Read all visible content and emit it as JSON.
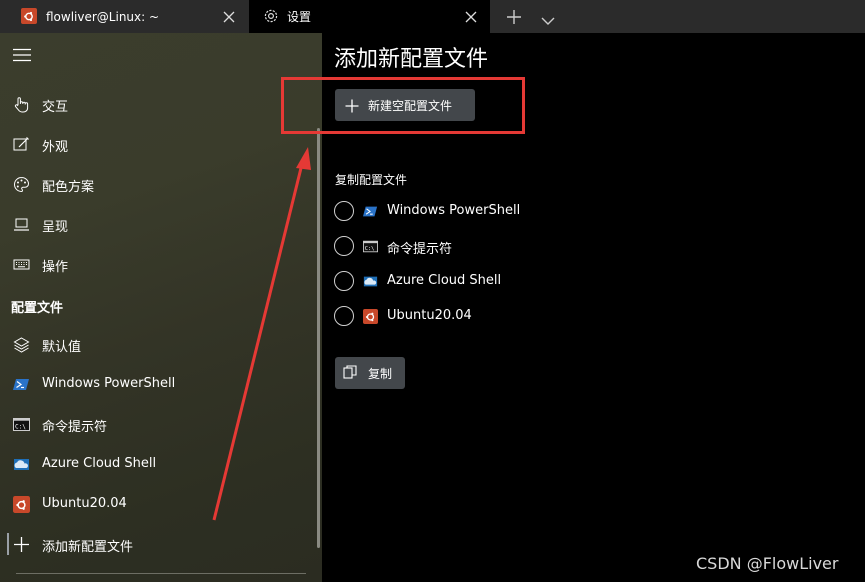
{
  "tabs": [
    {
      "label": "flowliver@Linux: ~",
      "icon": "ubuntu-icon",
      "active": false
    },
    {
      "label": "设置",
      "icon": "gear-icon",
      "active": true
    }
  ],
  "tabbar": {
    "new_tab_icon": "plus-icon",
    "dropdown_icon": "chevron-down-icon"
  },
  "sidebar": {
    "menu_icon": "hamburger-menu-icon",
    "items": [
      {
        "label": "交互",
        "icon": "hand-pointer-icon"
      },
      {
        "label": "外观",
        "icon": "appearance-icon"
      },
      {
        "label": "配色方案",
        "icon": "palette-icon"
      },
      {
        "label": "呈现",
        "icon": "monitor-icon"
      },
      {
        "label": "操作",
        "icon": "keyboard-icon"
      }
    ],
    "profiles_header": "配置文件",
    "profiles": [
      {
        "label": "默认值",
        "icon": "layers-icon"
      },
      {
        "label": "Windows PowerShell",
        "icon": "powershell-icon"
      },
      {
        "label": "命令提示符",
        "icon": "cmd-icon"
      },
      {
        "label": "Azure Cloud Shell",
        "icon": "azure-cloud-icon"
      },
      {
        "label": "Ubuntu20.04",
        "icon": "ubuntu-icon"
      },
      {
        "label": "添加新配置文件",
        "icon": "plus-icon"
      }
    ]
  },
  "main": {
    "title": "添加新配置文件",
    "new_button_label": "新建空配置文件",
    "duplicate_label": "复制配置文件",
    "duplicate_options": [
      {
        "label": "Windows PowerShell",
        "icon": "powershell-icon"
      },
      {
        "label": "命令提示符",
        "icon": "cmd-icon"
      },
      {
        "label": "Azure Cloud Shell",
        "icon": "azure-cloud-icon"
      },
      {
        "label": "Ubuntu20.04",
        "icon": "ubuntu-icon"
      }
    ],
    "duplicate_button_label": "复制"
  },
  "colors": {
    "accent_red": "#e53935",
    "button_bg": "#43474b",
    "ubuntu_orange": "#c8482a"
  },
  "watermark": "CSDN @FlowLiver"
}
